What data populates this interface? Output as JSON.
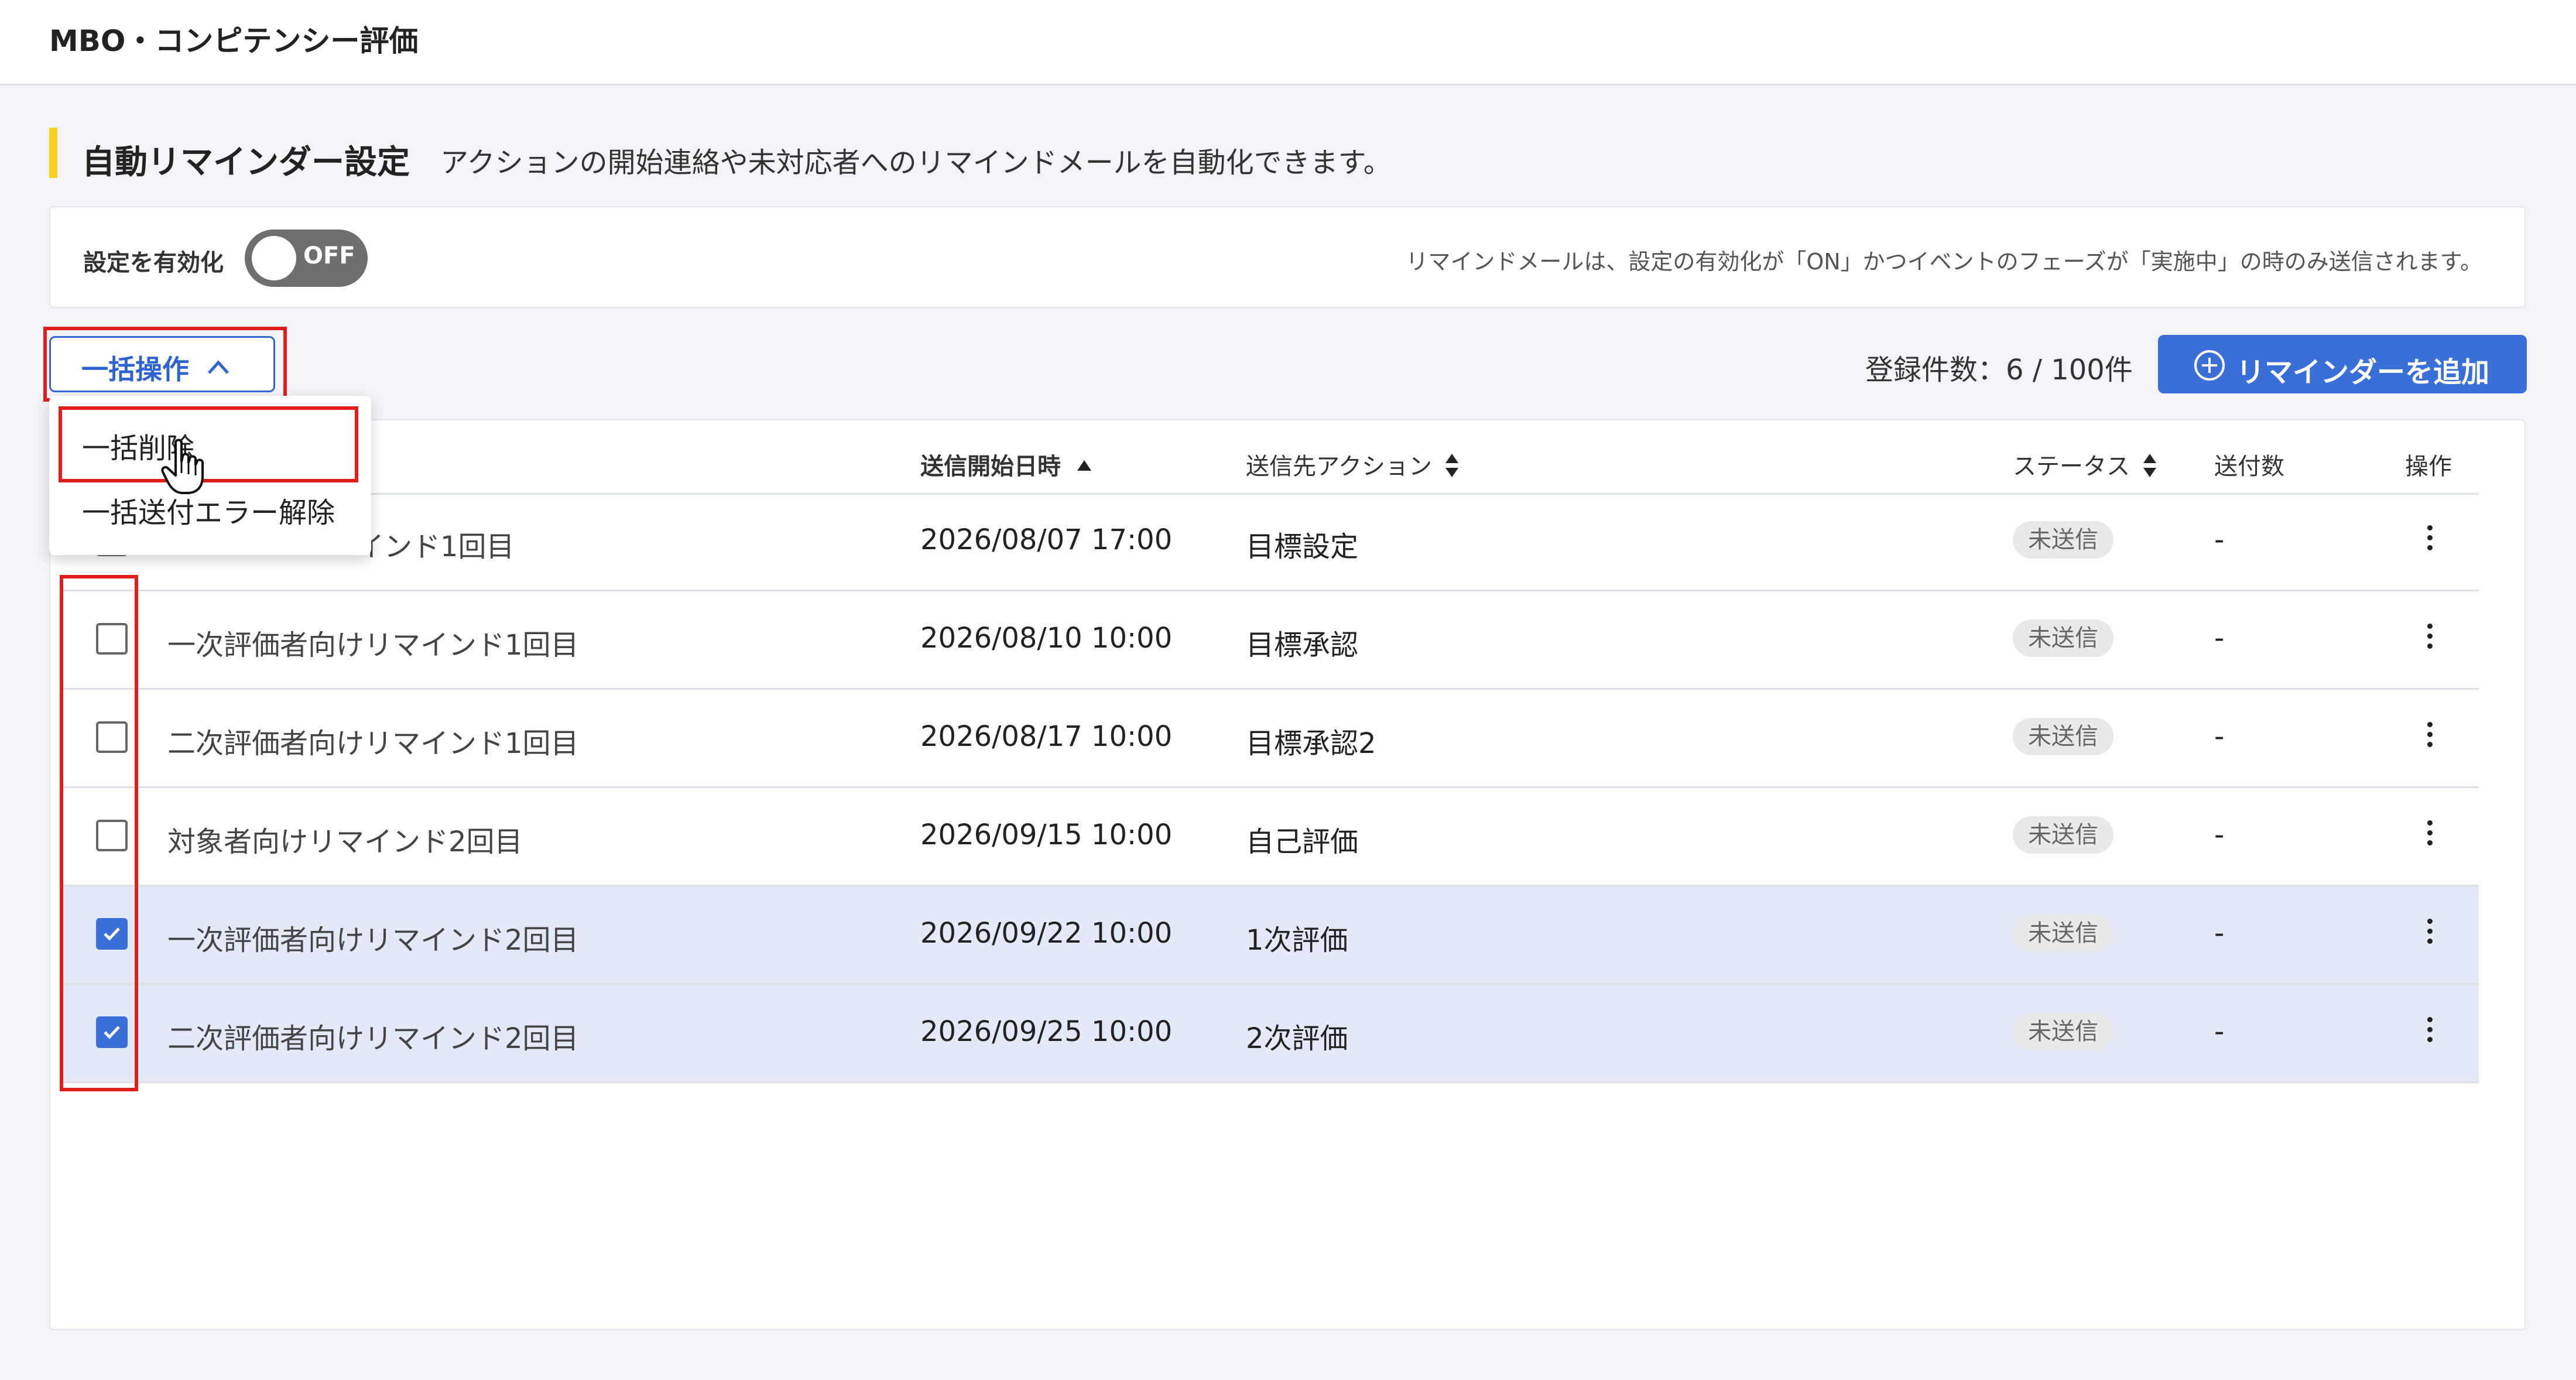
{
  "header": {
    "title": "MBO・コンピテンシー評価"
  },
  "section": {
    "title": "自動リマインダー設定",
    "description": "アクションの開始連絡や未対応者へのリマインドメールを自動化できます。"
  },
  "settings": {
    "enable_label": "設定を有効化",
    "toggle_state": "OFF",
    "note": "リマインドメールは、設定の有効化が「ON」かつイベントのフェーズが「実施中」の時のみ送信されます。"
  },
  "toolbar": {
    "bulk_label": "一括操作",
    "count_text": "登録件数：6 / 100件",
    "add_label": "リマインダーを追加"
  },
  "bulk_menu": {
    "items": [
      {
        "label": "一括削除"
      },
      {
        "label": "一括送付エラー解除"
      }
    ]
  },
  "table": {
    "columns": {
      "date": "送信開始日時",
      "action": "送信先アクション",
      "status": "ステータス",
      "sent": "送付数",
      "ops": "操作"
    },
    "rows": [
      {
        "name": "インド1回目",
        "date": "2026/08/07 17:00",
        "action": "目標設定",
        "status": "未送信",
        "sent": "-",
        "checked": false
      },
      {
        "name": "一次評価者向けリマインド1回目",
        "date": "2026/08/10 10:00",
        "action": "目標承認",
        "status": "未送信",
        "sent": "-",
        "checked": false
      },
      {
        "name": "二次評価者向けリマインド1回目",
        "date": "2026/08/17 10:00",
        "action": "目標承認2",
        "status": "未送信",
        "sent": "-",
        "checked": false
      },
      {
        "name": "対象者向けリマインド2回目",
        "date": "2026/09/15 10:00",
        "action": "自己評価",
        "status": "未送信",
        "sent": "-",
        "checked": false
      },
      {
        "name": "一次評価者向けリマインド2回目",
        "date": "2026/09/22 10:00",
        "action": "1次評価",
        "status": "未送信",
        "sent": "-",
        "checked": true
      },
      {
        "name": "二次評価者向けリマインド2回目",
        "date": "2026/09/25 10:00",
        "action": "2次評価",
        "status": "未送信",
        "sent": "-",
        "checked": true
      }
    ]
  },
  "colors": {
    "accent": "#3b6fd8",
    "highlight_box": "#e01e1e",
    "section_bar": "#f5d320",
    "selected_row": "#e3e9f6"
  }
}
